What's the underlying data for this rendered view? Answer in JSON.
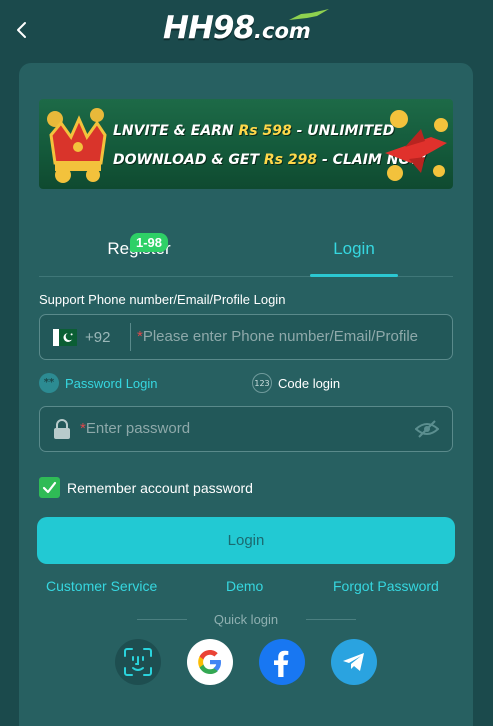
{
  "header": {
    "back_icon": "chevron-left-icon",
    "logo_main": "HH98",
    "logo_suffix": ".com"
  },
  "banner": {
    "line1_pre": "LNVITE & EARN ",
    "line1_amount": "Rs 598",
    "line1_post": " - UNLIMITED",
    "line2_pre": "DOWNLOAD & GET ",
    "line2_amount": "Rs 298",
    "line2_post": " - CLAIM NOW"
  },
  "tabs": {
    "register_label": "Register",
    "register_badge": "1-98",
    "login_label": "Login",
    "active": "Login"
  },
  "form": {
    "support_label": "Support Phone number/Email/Profile Login",
    "country_code": "+92",
    "required_mark": "*",
    "account_placeholder": "Please enter Phone number/Email/Profile",
    "mode_password_icon_text": "**",
    "mode_password_label": "Password Login",
    "mode_code_icon_text": "123",
    "mode_code_label": "Code login",
    "password_placeholder": "Enter password",
    "remember_label": "Remember account password",
    "remember_checked": true,
    "login_button": "Login"
  },
  "links": {
    "customer_service": "Customer Service",
    "demo": "Demo",
    "forgot_password": "Forgot Password"
  },
  "quick_login": {
    "label": "Quick login",
    "providers": [
      "face-id",
      "google",
      "facebook",
      "telegram"
    ]
  },
  "colors": {
    "background": "#1b4a4c",
    "card": "#276061",
    "accent": "#22c9d3",
    "badge": "#2ed066",
    "checkbox": "#2fbb56",
    "required": "#e0474c"
  }
}
